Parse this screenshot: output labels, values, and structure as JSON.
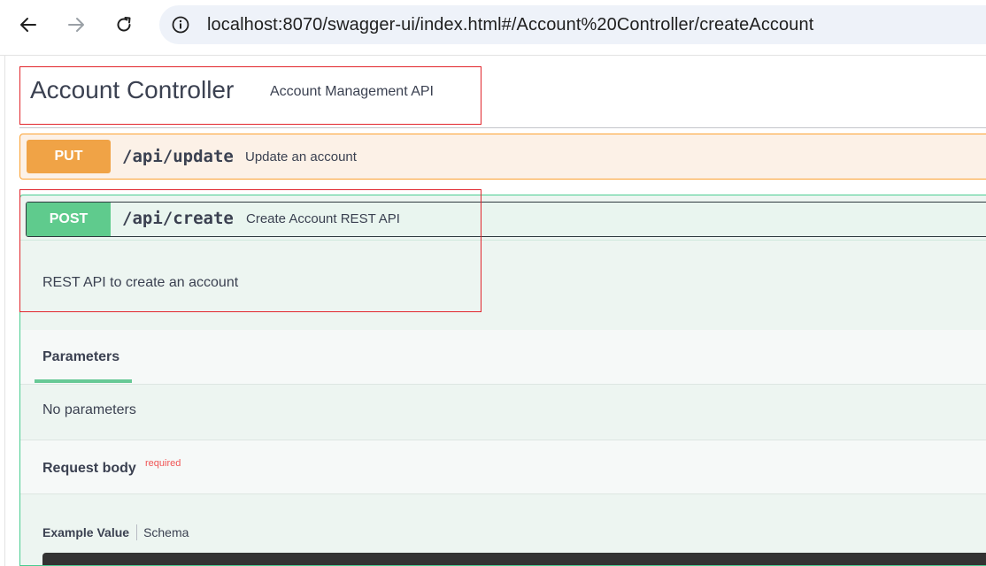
{
  "browser": {
    "url": "localhost:8070/swagger-ui/index.html#/Account%20Controller/createAccount",
    "icons": [
      "back-arrow-icon",
      "forward-arrow-icon",
      "reload-icon",
      "info-icon"
    ]
  },
  "tag": {
    "name": "Account Controller",
    "description": "Account Management API"
  },
  "operations": [
    {
      "method": "PUT",
      "path": "/api/update",
      "summary": "Update an account",
      "color": "#fca130",
      "expanded": false
    },
    {
      "method": "POST",
      "path": "/api/create",
      "summary": "Create Account REST API",
      "description": "REST API to create an account",
      "color": "#49cc90",
      "expanded": true,
      "parameters": {
        "tab_label": "Parameters",
        "empty_text": "No parameters"
      },
      "request_body": {
        "label": "Request body",
        "required_label": "required",
        "tabs": [
          "Example Value",
          "Schema"
        ]
      }
    }
  ],
  "colors": {
    "annotation_red": "#e1252c",
    "put": "#fca130",
    "post": "#49cc90"
  }
}
